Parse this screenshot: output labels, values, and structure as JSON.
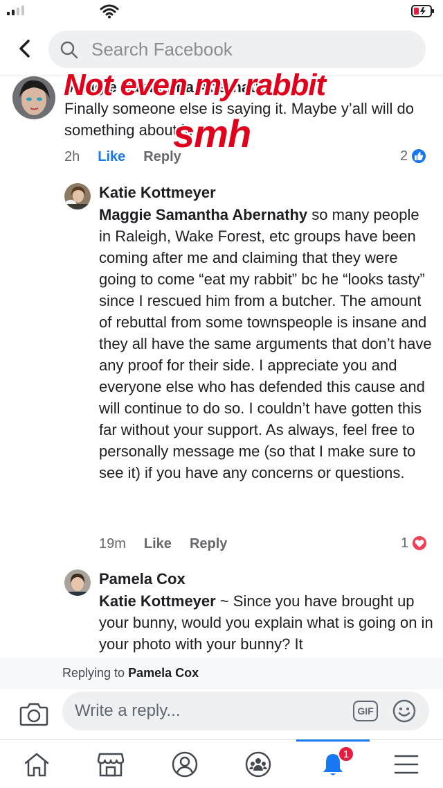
{
  "search": {
    "placeholder": "Search Facebook"
  },
  "sticker": {
    "line1": "Not even my rabbit",
    "line2": "smh"
  },
  "comment1": {
    "name": "Maggie Samantha Abernathy",
    "text": "Finally someone else is saying it. Maybe y’all will do something about it.",
    "time": "2h",
    "like_label": "Like",
    "reply_label": "Reply",
    "reaction_count": "2",
    "reaction_icon": "thumbs-up-icon",
    "accent": "#1877f2"
  },
  "comment2": {
    "name": "Katie Kottmeyer",
    "mention": "Maggie Samantha Abernathy",
    "text": " so many people in Raleigh, Wake Forest, etc groups have been coming after me and claiming that they were going to come “eat my rabbit” bc he “looks tasty” since I rescued him from a butcher. The amount of rebuttal from some townspeople is insane and they all have the same arguments that don’t have any proof for their side. I appreciate you and everyone else who has defended this cause and will continue to do so. I couldn’t have gotten this far without your support. As always, feel free to personally message me (so that I make sure to see it) if you have any concerns or questions.",
    "time": "19m",
    "like_label": "Like",
    "reply_label": "Reply",
    "reaction_count": "1",
    "reaction_icon": "heart-icon",
    "reaction_color": "#f33e58"
  },
  "comment3": {
    "name": "Pamela Cox",
    "mention": "Katie Kottmeyer",
    "text": " ~ Since you have brought up your bunny, would you explain what is going on in your photo with your bunny? It"
  },
  "reply_bar": {
    "prefix": "Replying to ",
    "target": "Pamela Cox",
    "placeholder": "Write a reply...",
    "gif_label": "GIF"
  },
  "tabs": [
    {
      "icon": "home-icon"
    },
    {
      "icon": "marketplace-icon"
    },
    {
      "icon": "profile-icon"
    },
    {
      "icon": "groups-icon"
    },
    {
      "icon": "notifications-icon",
      "badge": "1",
      "active": true
    },
    {
      "icon": "menu-icon"
    }
  ]
}
